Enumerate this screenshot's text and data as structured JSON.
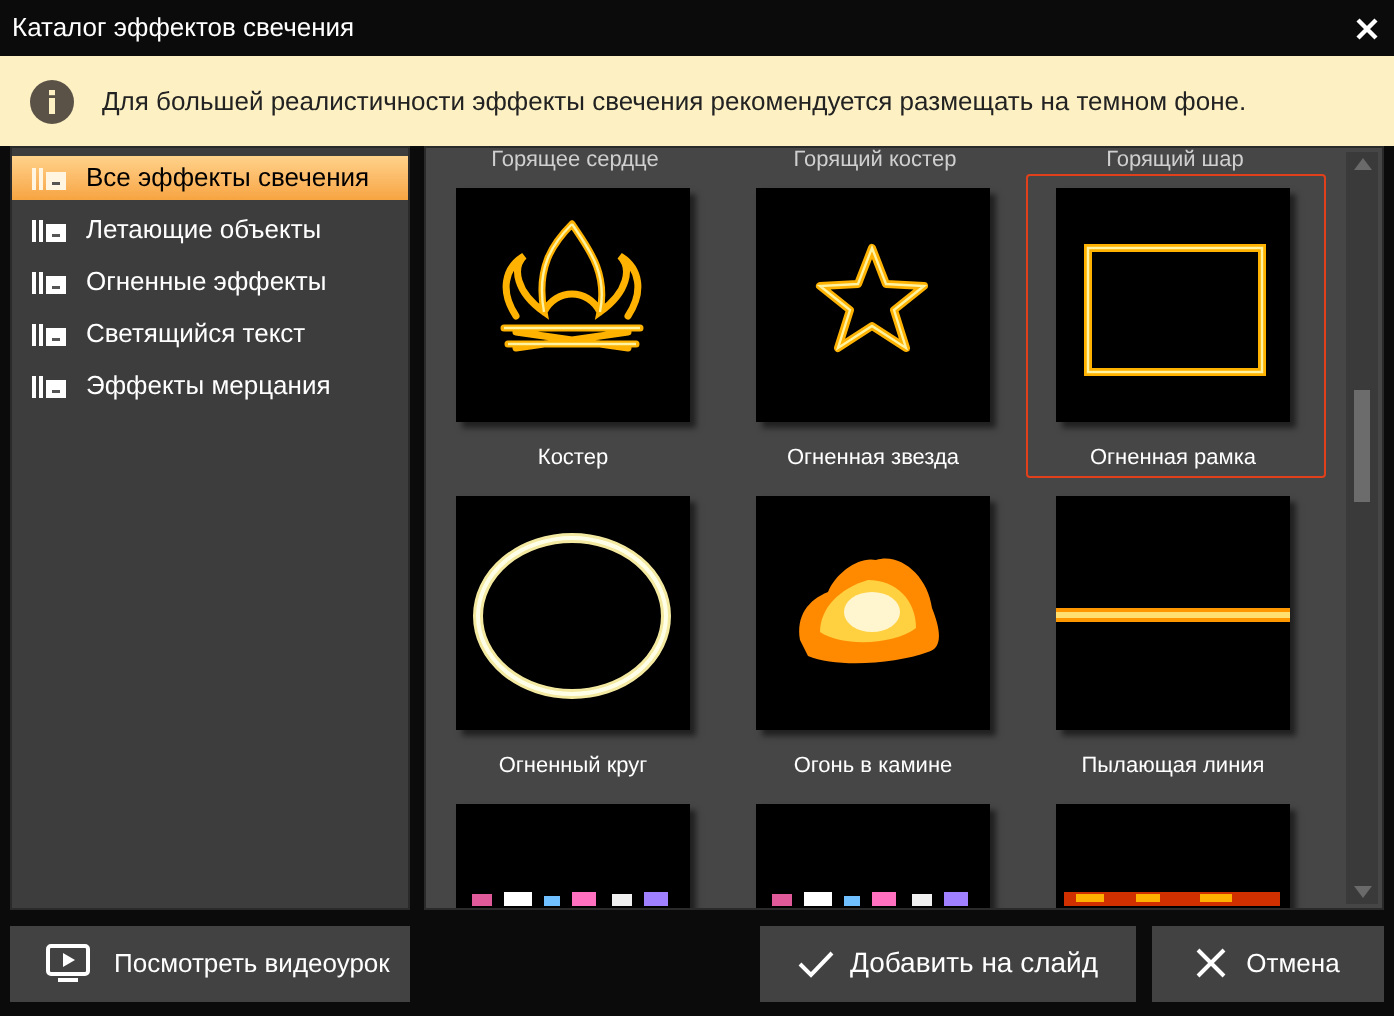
{
  "window": {
    "title": "Каталог эффектов свечения"
  },
  "notice": {
    "text": "Для большей реалистичности эффекты свечения рекомендуется размещать на темном фоне."
  },
  "sidebar": {
    "items": [
      {
        "label": "Все эффекты свечения",
        "selected": true
      },
      {
        "label": "Летающие объекты",
        "selected": false
      },
      {
        "label": "Огненные эффекты",
        "selected": false
      },
      {
        "label": "Светящийся текст",
        "selected": false
      },
      {
        "label": "Эффекты мерцания",
        "selected": false
      }
    ]
  },
  "gallery": {
    "cut_labels": [
      "Горящее сердце",
      "Горящий костер",
      "Горящий шар"
    ],
    "effects": [
      {
        "kind": "bonfire",
        "label": "Костер",
        "selected": false
      },
      {
        "kind": "star",
        "label": "Огненная звезда",
        "selected": false
      },
      {
        "kind": "frame",
        "label": "Огненная рамка",
        "selected": true
      },
      {
        "kind": "circle",
        "label": "Огненный круг",
        "selected": false
      },
      {
        "kind": "blaze",
        "label": "Огонь в камине",
        "selected": false
      },
      {
        "kind": "line",
        "label": "Пылающая линия",
        "selected": false
      },
      {
        "kind": "sparkles",
        "selected": false
      },
      {
        "kind": "sparkles",
        "selected": false
      },
      {
        "kind": "flames",
        "selected": false
      }
    ]
  },
  "buttons": {
    "tutorial": "Посмотреть видеоурок",
    "add": "Добавить на слайд",
    "cancel": "Отмена"
  }
}
